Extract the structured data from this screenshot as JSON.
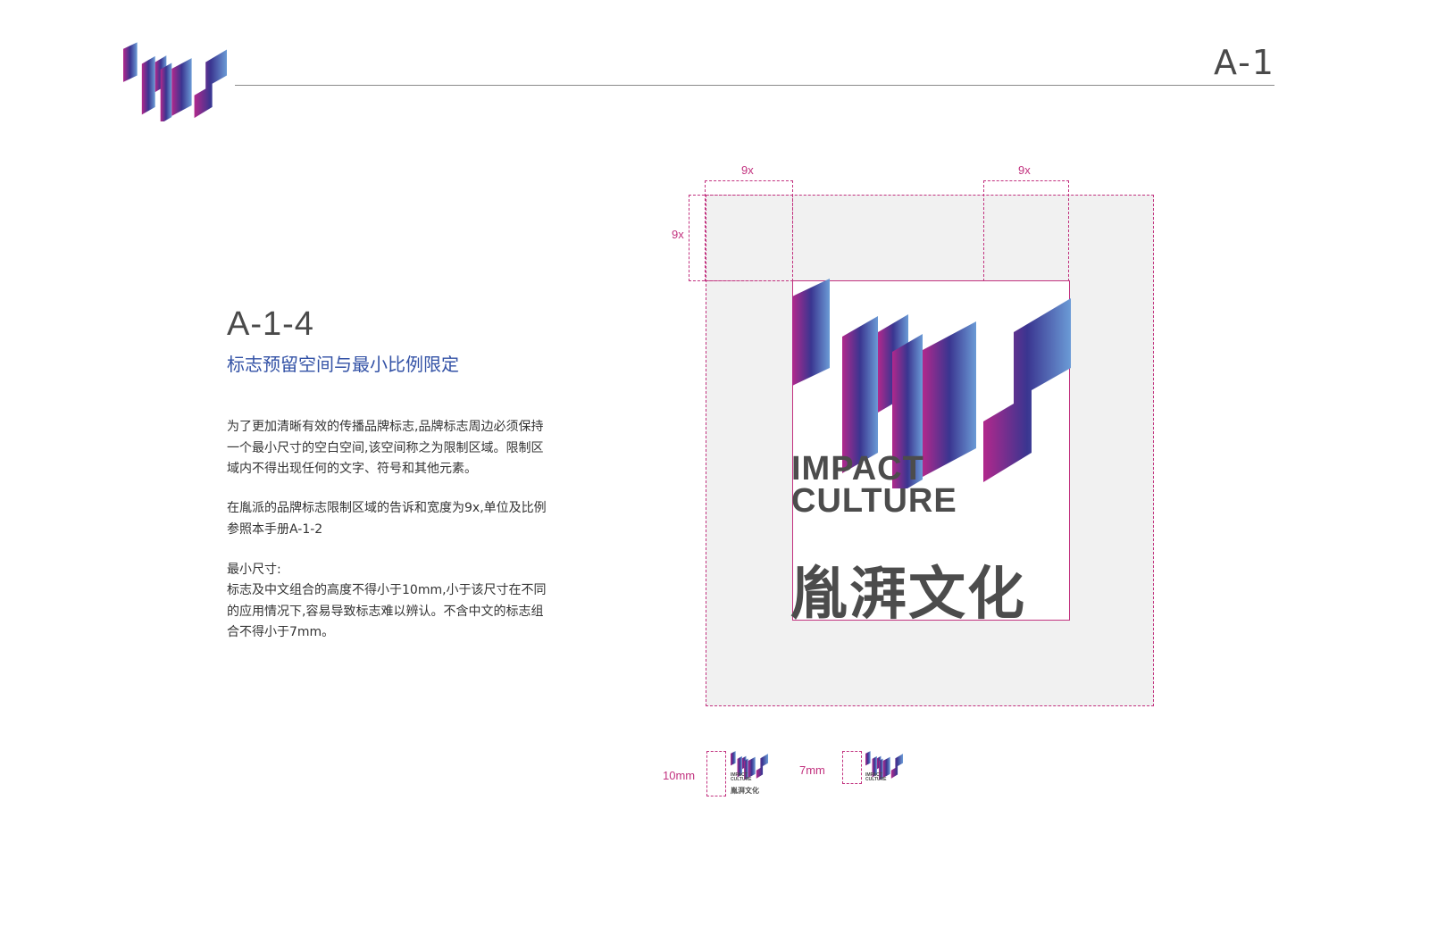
{
  "header": {
    "page_number": "A-1"
  },
  "section": {
    "code": "A-1-4",
    "title": "标志预留空间与最小比例限定"
  },
  "body": {
    "para1": "为了更加清晰有效的传播品牌标志,品牌标志周边必须保持一个最小尺寸的空白空间,该空间称之为限制区域。限制区域内不得出现任何的文字、符号和其他元素。",
    "para2": "在胤派的品牌标志限制区域的告诉和宽度为9x,单位及比例参照本手册A-1-2",
    "para3_label": "最小尺寸:",
    "para3": "标志及中文组合的高度不得小于10mm,小于该尺寸在不同的应用情况下,容易导致标志难以辨认。不含中文的标志组合不得小于7mm。"
  },
  "diagram": {
    "dim_top_left": "9x",
    "dim_top_right": "9x",
    "dim_left": "9x",
    "wordmark_line1": "IMPACT",
    "wordmark_line2": "CULTURE",
    "chinese_name": "胤湃文化",
    "min_size_with_cn": "10mm",
    "min_size_without_cn": "7mm"
  },
  "colors": {
    "gradient_start": "#b2288c",
    "gradient_mid": "#3a3590",
    "gradient_end": "#6b9bd6",
    "guide_line": "#c2327f",
    "title_blue": "#3352a6"
  }
}
